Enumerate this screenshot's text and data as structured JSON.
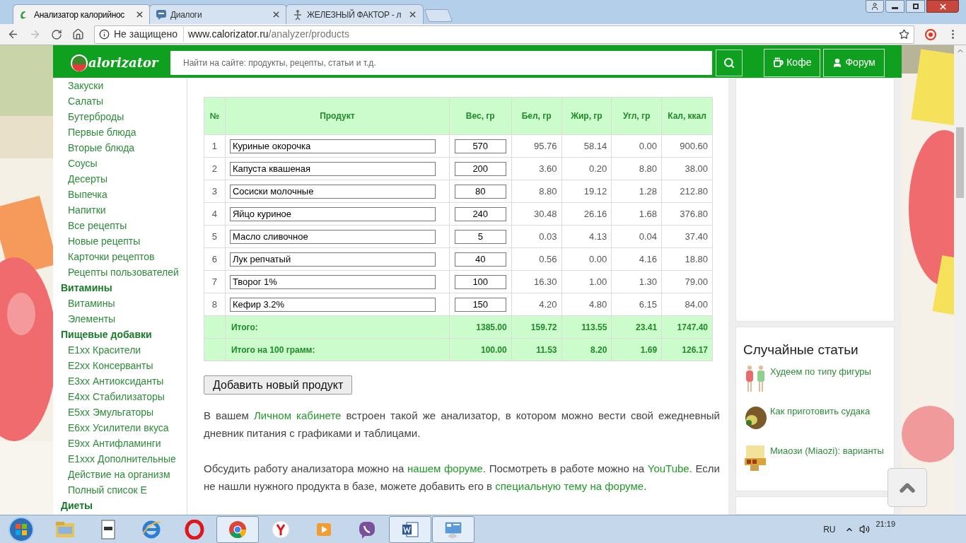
{
  "browser": {
    "tabs": [
      {
        "title": "Анализатор калорийнос",
        "kind": "site",
        "selected": true
      },
      {
        "title": "Диалоги",
        "kind": "chat",
        "selected": false
      },
      {
        "title": "ЖЕЛЕЗНЫЙ ФАКТОР - л",
        "kind": "gym",
        "selected": false
      }
    ],
    "security": "Не защищено",
    "url_host": "www.calorizator.ru",
    "url_path": "/analyzer/products"
  },
  "header": {
    "logo": "alorizator",
    "search_placeholder": "Найти на сайте: продукты, рецепты, статьи и т.д.",
    "buttons": [
      {
        "label": "Кофе",
        "kind": "cup"
      },
      {
        "label": "Форум",
        "kind": "user"
      }
    ]
  },
  "sidebar": {
    "items": [
      {
        "label": "Закуски",
        "kind": "link"
      },
      {
        "label": "Салаты",
        "kind": "link"
      },
      {
        "label": "Бутерброды",
        "kind": "link"
      },
      {
        "label": "Первые блюда",
        "kind": "link"
      },
      {
        "label": "Вторые блюда",
        "kind": "link"
      },
      {
        "label": "Соусы",
        "kind": "link"
      },
      {
        "label": "Десерты",
        "kind": "link"
      },
      {
        "label": "Выпечка",
        "kind": "link"
      },
      {
        "label": "Напитки",
        "kind": "link"
      },
      {
        "label": "Все рецепты",
        "kind": "link"
      },
      {
        "label": "Новые рецепты",
        "kind": "link"
      },
      {
        "label": "Карточки рецептов",
        "kind": "link"
      },
      {
        "label": "Рецепты пользователей",
        "kind": "link"
      },
      {
        "label": "Витамины",
        "kind": "heading"
      },
      {
        "label": "Витамины",
        "kind": "link"
      },
      {
        "label": "Элементы",
        "kind": "link"
      },
      {
        "label": "Пищевые добавки",
        "kind": "heading"
      },
      {
        "label": "E1xx Красители",
        "kind": "link"
      },
      {
        "label": "E2xx Консерванты",
        "kind": "link"
      },
      {
        "label": "E3xx Антиоксиданты",
        "kind": "link"
      },
      {
        "label": "E4xx Стабилизаторы",
        "kind": "link"
      },
      {
        "label": "E5xx Эмульгаторы",
        "kind": "link"
      },
      {
        "label": "E6xx Усилители вкуса",
        "kind": "link"
      },
      {
        "label": "E9xx Антифламинги",
        "kind": "link"
      },
      {
        "label": "E1xxx Дополнительные",
        "kind": "link"
      },
      {
        "label": "Действие на организм",
        "kind": "link"
      },
      {
        "label": "Полный список E",
        "kind": "link"
      },
      {
        "label": "Диеты",
        "kind": "heading"
      }
    ]
  },
  "table": {
    "columns": [
      "№",
      "Продукт",
      "Вес, гр",
      "Бел, гр",
      "Жир, гр",
      "Угл, гр",
      "Кал, ккал"
    ],
    "rows": [
      [
        "1",
        "Куриные окорочка",
        "570",
        "95.76",
        "58.14",
        "0.00",
        "900.60"
      ],
      [
        "2",
        "Капуста квашеная",
        "200",
        "3.60",
        "0.20",
        "8.80",
        "38.00"
      ],
      [
        "3",
        "Сосиски молочные",
        "80",
        "8.80",
        "19.12",
        "1.28",
        "212.80"
      ],
      [
        "4",
        "Яйцо куриное",
        "240",
        "30.48",
        "26.16",
        "1.68",
        "376.80"
      ],
      [
        "5",
        "Масло сливочное",
        "5",
        "0.03",
        "4.13",
        "0.04",
        "37.40"
      ],
      [
        "6",
        "Лук репчатый",
        "40",
        "0.56",
        "0.00",
        "4.16",
        "18.80"
      ],
      [
        "7",
        "Творог 1%",
        "100",
        "16.30",
        "1.00",
        "1.30",
        "79.00"
      ],
      [
        "8",
        "Кефир 3.2%",
        "150",
        "4.20",
        "4.80",
        "6.15",
        "84.00"
      ]
    ],
    "totals": [
      [
        "Итого:",
        "1385.00",
        "159.72",
        "113.55",
        "23.41",
        "1747.40"
      ],
      [
        "Итого на 100 грамм:",
        "100.00",
        "11.53",
        "8.20",
        "1.69",
        "126.17"
      ]
    ]
  },
  "add_button": "Добавить новый продукт",
  "paragraphs": [
    [
      {
        "text": "В вашем ",
        "kind": "text"
      },
      {
        "text": "Личном кабинете",
        "kind": "link"
      },
      {
        "text": " встроен такой же анализатор, в котором можно вести свой ежедневный дневник питания с графиками и таблицами.",
        "kind": "text"
      }
    ],
    [
      {
        "text": "Обсудить работу анализатора можно на ",
        "kind": "text"
      },
      {
        "text": "нашем форуме",
        "kind": "link"
      },
      {
        "text": ". Посмотреть в работе можно на ",
        "kind": "text"
      },
      {
        "text": "YouTube",
        "kind": "link"
      },
      {
        "text": ". Если не нашли нужного продукта в базе, можете добавить его в ",
        "kind": "text"
      },
      {
        "text": "специальную тему на форуме",
        "kind": "link"
      },
      {
        "text": ".",
        "kind": "text"
      }
    ]
  ],
  "random_articles": {
    "title": "Случайные статьи",
    "items": [
      {
        "title": "Худеем по типу фигуры",
        "kind": "figures"
      },
      {
        "title": "Как приготовить судака",
        "kind": "fish"
      },
      {
        "title": "Миаози (Miaozi): варианты",
        "kind": "box"
      }
    ]
  },
  "taskbar": {
    "apps": [
      {
        "kind": "folder",
        "highlighted": false
      },
      {
        "kind": "doc",
        "highlighted": false
      },
      {
        "kind": "ie",
        "highlighted": false
      },
      {
        "kind": "opera",
        "highlighted": false
      },
      {
        "kind": "chrome",
        "highlighted": true
      },
      {
        "kind": "yandex",
        "highlighted": false
      },
      {
        "kind": "player",
        "highlighted": false
      },
      {
        "kind": "viber",
        "highlighted": false
      },
      {
        "kind": "word",
        "highlighted": true
      },
      {
        "kind": "panel",
        "highlighted": true
      }
    ],
    "language": "RU",
    "time": "21:19"
  }
}
